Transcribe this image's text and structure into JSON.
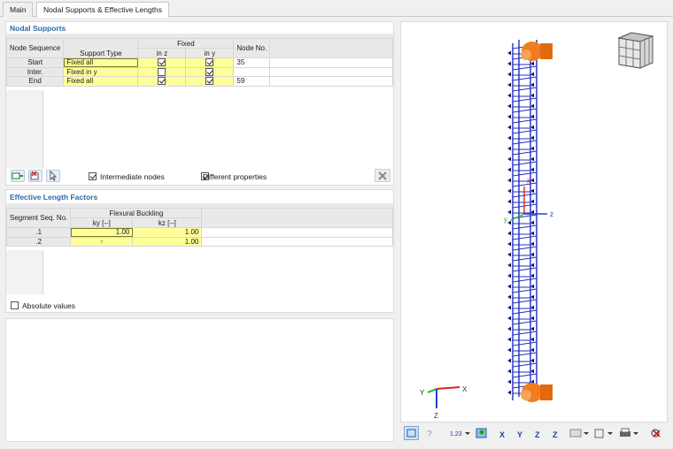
{
  "tabs": [
    {
      "label": "Main"
    },
    {
      "label": "Nodal Supports & Effective Lengths"
    }
  ],
  "nodal_supports": {
    "title": "Nodal Supports",
    "headers": {
      "node_sequence": "Node Sequence",
      "support_type": "Support Type",
      "fixed": "Fixed",
      "in_z": "in z",
      "in_y": "in y",
      "node_no": "Node No."
    },
    "rows": [
      {
        "seq": "Start",
        "type": "Fixed all",
        "in_z": true,
        "in_y": true,
        "node": "35"
      },
      {
        "seq": "Inter.",
        "type": "Fixed in y",
        "in_z": false,
        "in_y": true,
        "node": ""
      },
      {
        "seq": "End",
        "type": "Fixed all",
        "in_z": true,
        "in_y": true,
        "node": "59"
      }
    ],
    "intermediate_nodes_label": "Intermediate nodes",
    "intermediate_nodes_checked": true,
    "different_properties_label": "Different properties",
    "different_properties_checked": true
  },
  "effective_length": {
    "title": "Effective Length Factors",
    "headers": {
      "segment": "Segment Seq. No.",
      "flexural": "Flexural Buckling",
      "ky": "ky [--]",
      "kz": "kz [--]"
    },
    "rows": [
      {
        "seg": ".1",
        "ky": "1.00",
        "kz": "1.00"
      },
      {
        "seg": ".2",
        "ky": "",
        "kz": "1.00"
      }
    ],
    "absolute_values_label": "Absolute values",
    "absolute_values_checked": false
  },
  "view": {
    "axis_labels": {
      "x": "X",
      "y": "Y",
      "z": "Z"
    },
    "local_axis": {
      "x": "x",
      "y": "y",
      "z": "z"
    },
    "colors": {
      "member": "#1f2fbf",
      "support": "#f07d1e",
      "axis_x": "#e02020",
      "axis_y": "#20b020",
      "axis_z": "#2040e0"
    }
  },
  "toolbar_icons": [
    "select-icon",
    "info-icon",
    "numbering-icon",
    "render-icon",
    "view-x-icon",
    "view-y-icon",
    "view-z-icon",
    "view-iso-icon",
    "display-icon",
    "cube-icon",
    "print-icon",
    "reset-icon"
  ]
}
